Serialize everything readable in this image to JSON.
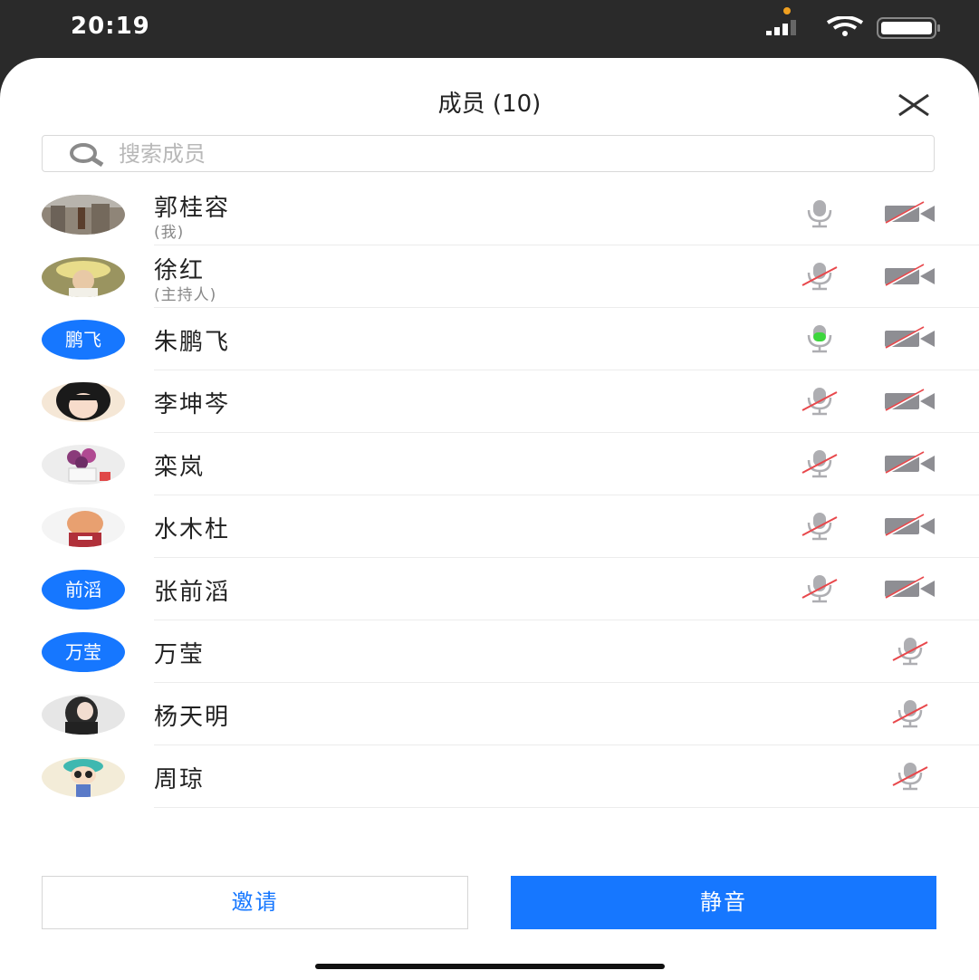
{
  "status_bar": {
    "time": "20:19"
  },
  "header": {
    "title": "成员 (10)"
  },
  "search": {
    "placeholder": "搜索成员"
  },
  "members": [
    {
      "name": "郭桂容",
      "role": "(我)",
      "avatar_text": "",
      "mic": "on",
      "camera": "off"
    },
    {
      "name": "徐红",
      "role": "(主持人)",
      "avatar_text": "",
      "mic": "off",
      "camera": "off"
    },
    {
      "name": "朱鹏飞",
      "role": "",
      "avatar_text": "鹏飞",
      "mic": "speaking",
      "camera": "off"
    },
    {
      "name": "李坤芩",
      "role": "",
      "avatar_text": "",
      "mic": "off",
      "camera": "off"
    },
    {
      "name": "栾岚",
      "role": "",
      "avatar_text": "",
      "mic": "off",
      "camera": "off"
    },
    {
      "name": "水木杜",
      "role": "",
      "avatar_text": "",
      "mic": "off",
      "camera": "off"
    },
    {
      "name": "张前滔",
      "role": "",
      "avatar_text": "前滔",
      "mic": "off",
      "camera": "off"
    },
    {
      "name": "万莹",
      "role": "",
      "avatar_text": "万莹",
      "mic": "off",
      "camera": "none"
    },
    {
      "name": "杨天明",
      "role": "",
      "avatar_text": "",
      "mic": "off",
      "camera": "none"
    },
    {
      "name": "周琼",
      "role": "",
      "avatar_text": "",
      "mic": "off",
      "camera": "none"
    }
  ],
  "actions": {
    "invite_label": "邀请",
    "mute_label": "静音"
  },
  "colors": {
    "accent": "#1677ff",
    "speaking": "#3dd63d",
    "muted_slash": "#e8474b",
    "icon_gray": "#8e8e93"
  }
}
